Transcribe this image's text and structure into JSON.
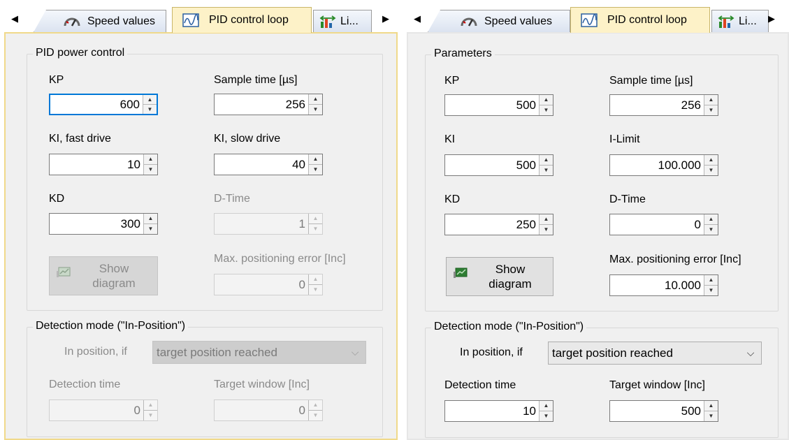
{
  "tabs": {
    "speed": "Speed values",
    "pid": "PID control loop",
    "limits": "Li..."
  },
  "left": {
    "group1_title": "PID power control",
    "kp_label": "KP",
    "kp_value": "600",
    "sample_label": "Sample time [µs]",
    "sample_value": "256",
    "ki_fast_label": "KI, fast drive",
    "ki_fast_value": "10",
    "ki_slow_label": "KI, slow drive",
    "ki_slow_value": "40",
    "kd_label": "KD",
    "kd_value": "300",
    "dtime_label": "D-Time",
    "dtime_value": "1",
    "show_diagram_label": "Show diagram",
    "maxpos_label": "Max. positioning error [Inc]",
    "maxpos_value": "0",
    "group2_title": "Detection mode (\"In-Position\")",
    "inpos_label": "In position, if",
    "inpos_value": "target position reached",
    "dettime_label": "Detection time",
    "dettime_value": "0",
    "window_label": "Target window [Inc]",
    "window_value": "0"
  },
  "right": {
    "group1_title": "Parameters",
    "kp_label": "KP",
    "kp_value": "500",
    "sample_label": "Sample time [µs]",
    "sample_value": "256",
    "ki_label": "KI",
    "ki_value": "500",
    "ilimit_label": "I-Limit",
    "ilimit_value": "100.000",
    "kd_label": "KD",
    "kd_value": "250",
    "dtime_label": "D-Time",
    "dtime_value": "0",
    "show_diagram_label": "Show diagram",
    "maxpos_label": "Max. positioning error [Inc]",
    "maxpos_value": "10.000",
    "group2_title": "Detection mode (\"In-Position\")",
    "inpos_label": "In position, if",
    "inpos_value": "target position reached",
    "dettime_label": "Detection time",
    "dettime_value": "10",
    "window_label": "Target window [Inc]",
    "window_value": "500"
  }
}
